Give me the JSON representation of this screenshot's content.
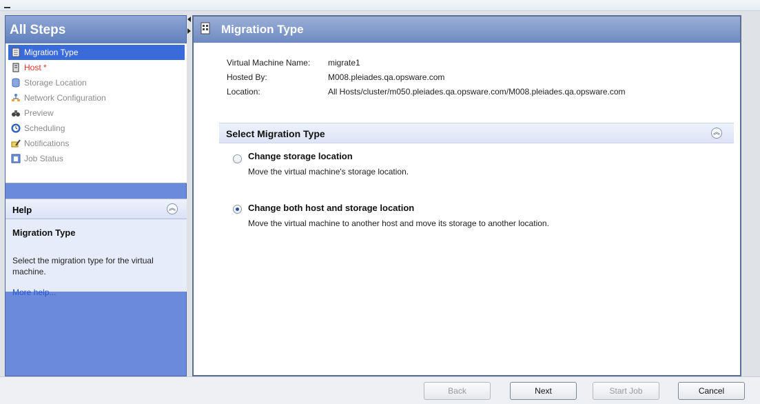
{
  "steps_panel": {
    "title": "All Steps",
    "items": [
      {
        "label": "Migration Type",
        "icon": "page-icon",
        "state": "active"
      },
      {
        "label": "Host *",
        "icon": "server-icon",
        "state": "required"
      },
      {
        "label": "Storage Location",
        "icon": "database-icon",
        "state": "disabled"
      },
      {
        "label": "Network Configuration",
        "icon": "network-icon",
        "state": "disabled"
      },
      {
        "label": "Preview",
        "icon": "binoculars-icon",
        "state": "disabled"
      },
      {
        "label": "Scheduling",
        "icon": "clock-icon",
        "state": "disabled"
      },
      {
        "label": "Notifications",
        "icon": "envelope-pen-icon",
        "state": "disabled"
      },
      {
        "label": "Job Status",
        "icon": "job-status-icon",
        "state": "disabled"
      }
    ]
  },
  "help": {
    "title": "Help",
    "heading": "Migration Type",
    "text": "Select the migration type for the virtual machine.",
    "link": "More help..."
  },
  "main": {
    "title": "Migration Type",
    "info": [
      {
        "label": "Virtual Machine Name:",
        "value": "migrate1"
      },
      {
        "label": "Hosted By:",
        "value": "M008.pleiades.qa.opsware.com"
      },
      {
        "label": "Location:",
        "value": "All Hosts/cluster/m050.pleiades.qa.opsware.com/M008.pleiades.qa.opsware.com"
      }
    ],
    "section_title": "Select Migration Type",
    "options": [
      {
        "title": "Change storage location",
        "description": "Move the virtual machine's storage location.",
        "selected": false
      },
      {
        "title": "Change both host and storage location",
        "description": "Move the virtual machine to another host and move its storage to another location.",
        "selected": true
      }
    ]
  },
  "buttons": {
    "back": "Back",
    "next": "Next",
    "start_job": "Start Job",
    "cancel": "Cancel"
  },
  "colors": {
    "active_step": "#3b6bd8",
    "required_step": "#e23227",
    "left_panel": "#6a8bdc",
    "header_gradient": "#6c89c1"
  }
}
